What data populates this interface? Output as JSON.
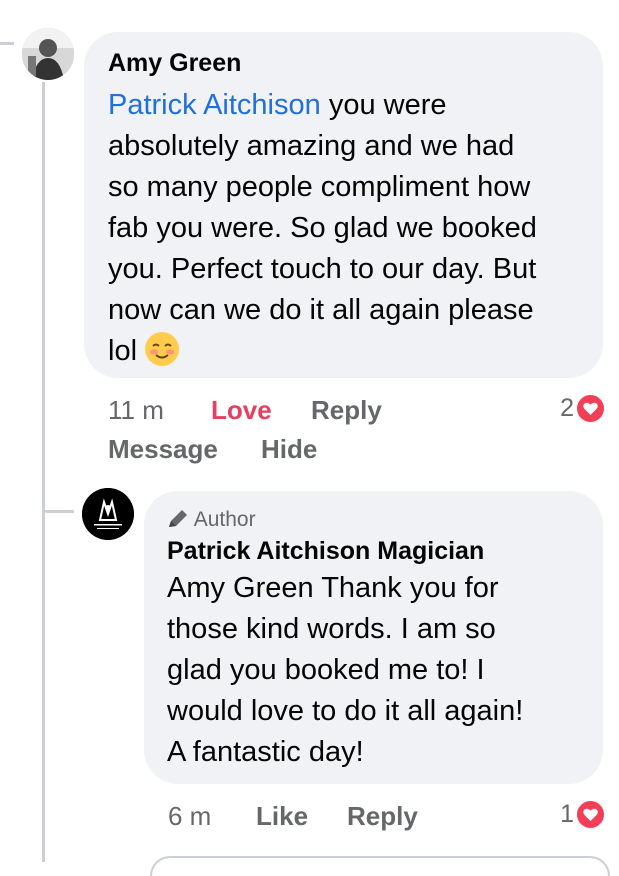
{
  "comments": [
    {
      "author": "Amy Green",
      "mention": "Patrick Aitchison",
      "text_parts": [
        " you were",
        "absolutely amazing and we had",
        "so many people compliment how",
        "fab you were. So glad we booked",
        "you. Perfect touch to our day. But",
        "now can we do it all again please",
        "lol"
      ],
      "emoji": "relieved-face",
      "time": "11 m",
      "actions": {
        "love": "Love",
        "reply": "Reply",
        "message": "Message",
        "hide": "Hide"
      },
      "reaction_count": "2"
    },
    {
      "badge": "Author",
      "author": "Patrick Aitchison Magician",
      "text_lines": [
        "Amy Green Thank you for",
        "those kind words. I am so",
        "glad you booked me to! I",
        "would love to do it all again!",
        "A fantastic day!"
      ],
      "time": "6 m",
      "actions": {
        "like": "Like",
        "reply": "Reply"
      },
      "reaction_count": "1"
    }
  ],
  "colors": {
    "love": "#e4405f",
    "heart": "#f33e58",
    "link": "#216fdb",
    "bubble": "#f0f2f5"
  }
}
